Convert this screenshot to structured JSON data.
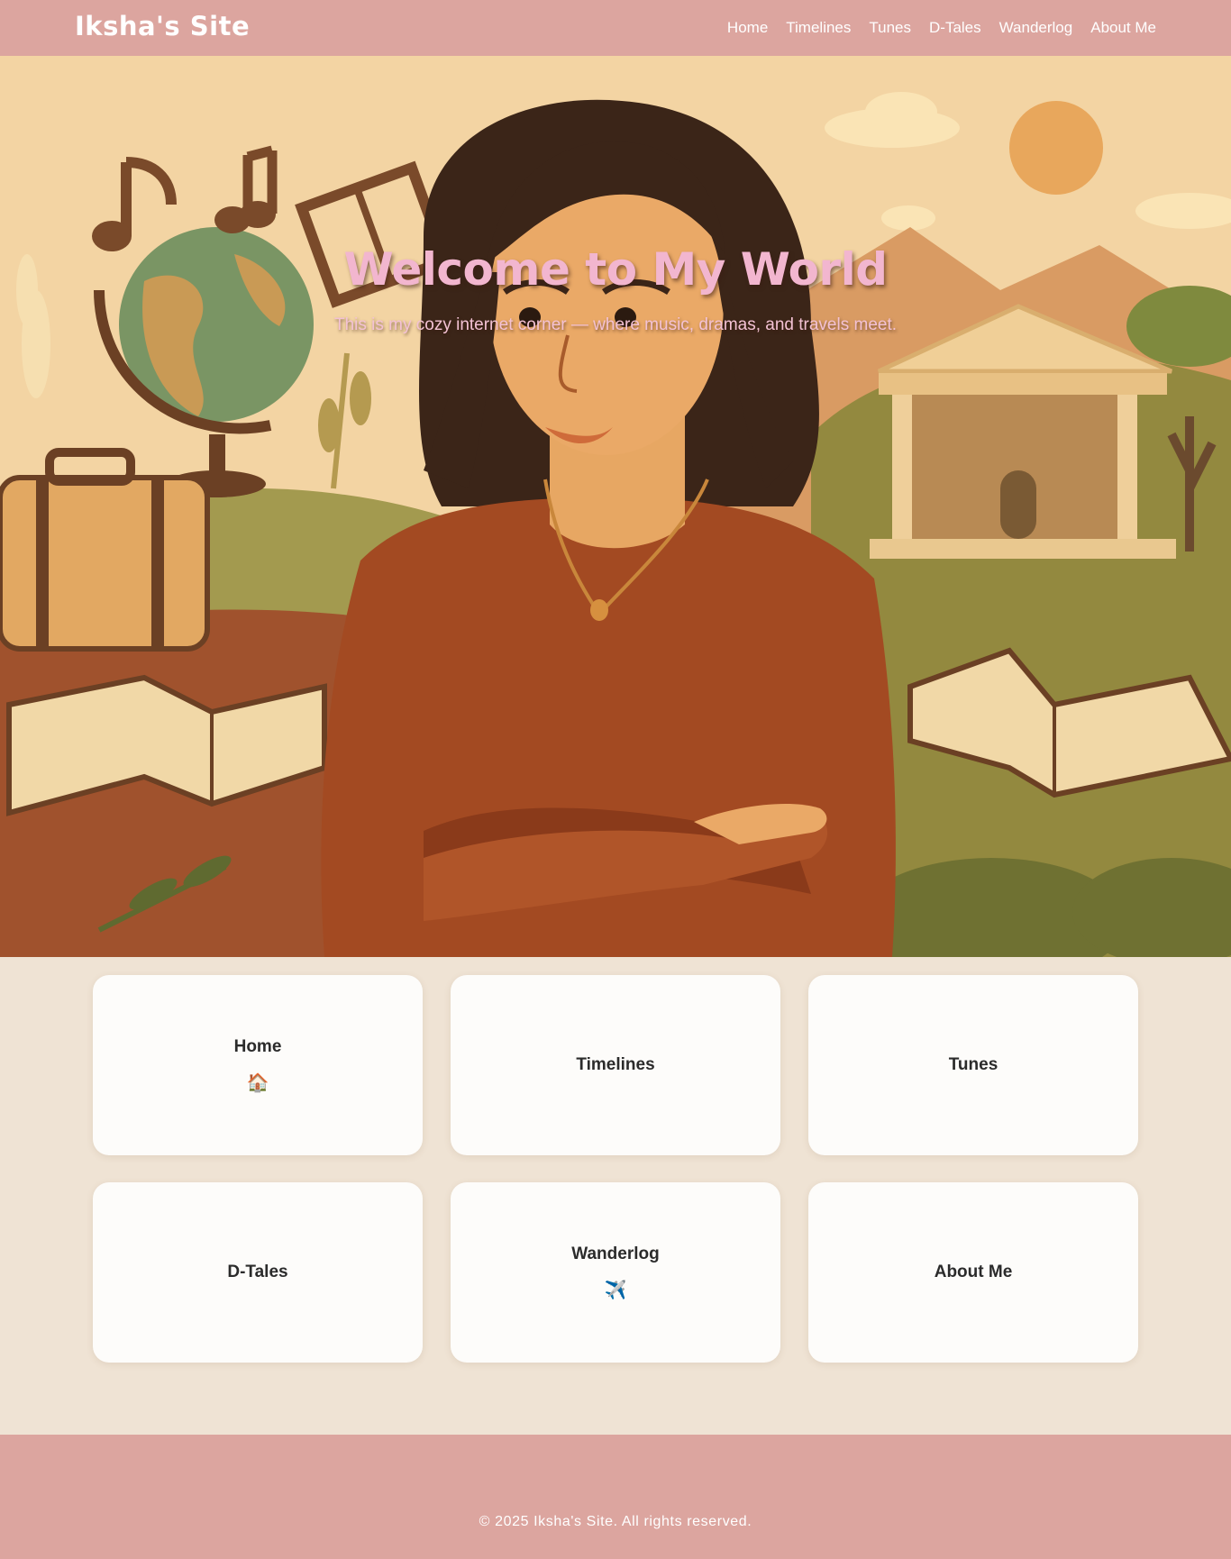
{
  "header": {
    "brand": "Iksha's Site",
    "nav": [
      "Home",
      "Timelines",
      "Tunes",
      "D-Tales",
      "Wanderlog",
      "About Me"
    ]
  },
  "hero": {
    "title": "Welcome to My World",
    "subtitle": "This is my cozy internet corner — where music, dramas, and travels meet."
  },
  "cards": [
    {
      "title": "Home",
      "icon": "🏠"
    },
    {
      "title": "Timelines",
      "icon": ""
    },
    {
      "title": "Tunes",
      "icon": ""
    },
    {
      "title": "D-Tales",
      "icon": ""
    },
    {
      "title": "Wanderlog",
      "icon": "✈️"
    },
    {
      "title": "About Me",
      "icon": ""
    }
  ],
  "footer": {
    "text": "© 2025 Iksha's Site. All rights reserved."
  },
  "colors": {
    "header_bg": "#dca59f",
    "page_bg": "#efe3d4",
    "card_bg": "#fdfcfa",
    "hero_title": "#f2b6cf"
  }
}
